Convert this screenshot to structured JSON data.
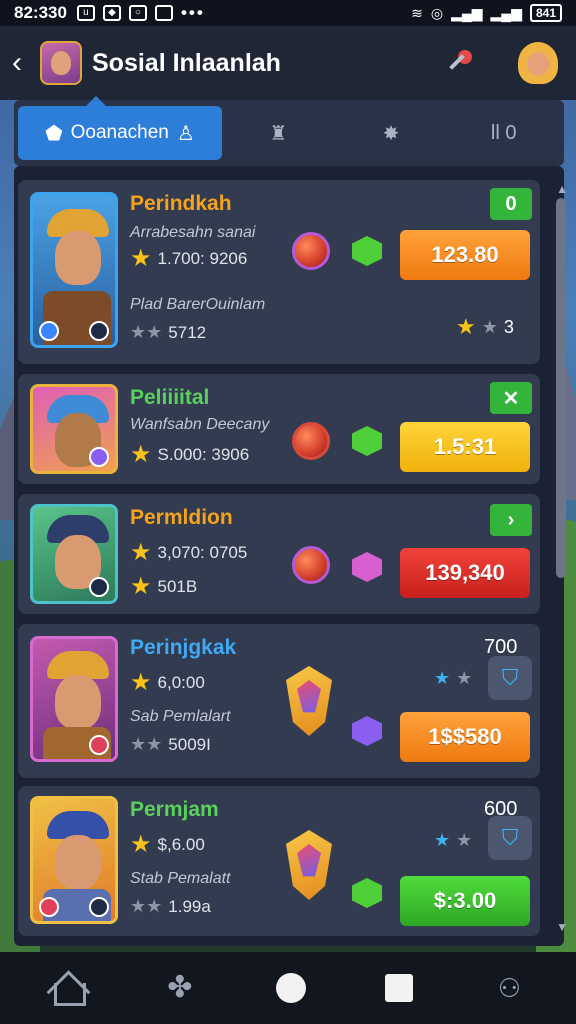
{
  "status_bar": {
    "time": "82:330",
    "battery": "841"
  },
  "header": {
    "title": "Sosial Inlaanlah"
  },
  "tabs": [
    {
      "label": "Ooanachen",
      "active": true
    },
    {
      "label": "",
      "icon": "trophy-icon"
    },
    {
      "label": "",
      "icon": "star-burst-icon"
    },
    {
      "label": "ll 0",
      "icon": "pause-icon"
    }
  ],
  "cards": [
    {
      "name": "Perindkah",
      "name_color": "#f6a31b",
      "subtitle": "Arrabesahn sanai",
      "value_line": "1.700: 9206",
      "sub_label": "Plad BarerOuinlam",
      "sub_value": "5712",
      "rating_value": "3",
      "tag": "0",
      "price": "123.80",
      "price_color": "orange"
    },
    {
      "name": "Peliiiital",
      "name_color": "#5ad15b",
      "subtitle": "Wanfsabn Deecany",
      "value_line": "S.000: 3906",
      "tag": "✕",
      "price": "1.5:31",
      "price_color": "yellow"
    },
    {
      "name": "Permldion",
      "name_color": "#f6a31b",
      "value_line": "3,070: 0705",
      "sub_value": "501B",
      "tag": "›",
      "price": "139,340",
      "price_color": "red"
    },
    {
      "name": "Perinjgkak",
      "name_color": "#3fa9f5",
      "value_line": "6,0:00",
      "sub_label": "Sab Pemlalart",
      "sub_value": "5009I",
      "count": "700",
      "price": "1$$580",
      "price_color": "orange"
    },
    {
      "name": "Permjam",
      "name_color": "#5ad15b",
      "value_line": "$,6.00",
      "sub_label": "Stab Pemalatt",
      "sub_value": "1.99a",
      "count": "600",
      "price": "$:3.00",
      "price_color": "green"
    }
  ],
  "bottom_nav": [
    "home-icon",
    "clover-icon",
    "circle-icon",
    "square-icon",
    "people-icon"
  ]
}
